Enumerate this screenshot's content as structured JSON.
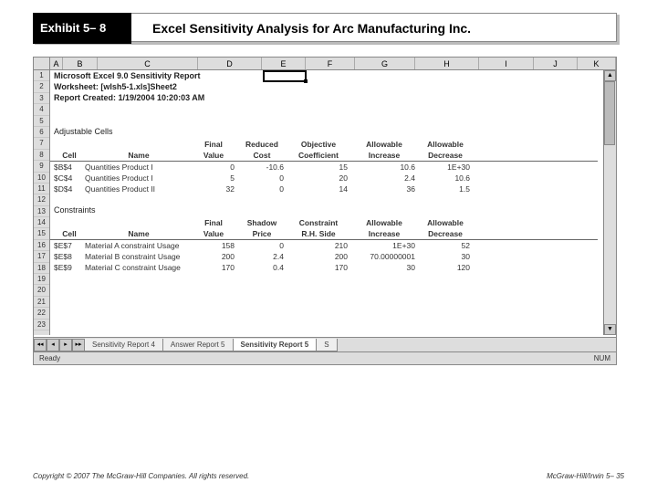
{
  "exhibit_label": "Exhibit 5– 8",
  "title": "Excel Sensitivity Analysis for Arc Manufacturing Inc.",
  "excel": {
    "columns": [
      "A",
      "B",
      "C",
      "D",
      "E",
      "F",
      "G",
      "H",
      "I",
      "J",
      "K"
    ],
    "row_count": 23,
    "active_cell": "E1",
    "report_header": {
      "l1": "Microsoft Excel 9.0 Sensitivity Report",
      "l2": "Worksheet: [wlsh5-1.xls]Sheet2",
      "l3": "Report Created: 1/19/2004 10:20:03 AM"
    },
    "section1_title": "Adjustable Cells",
    "section1_headers_top": {
      "cell": "",
      "name": "",
      "v1": "Final",
      "v2": "Reduced",
      "v3": "Objective",
      "v4": "Allowable",
      "v5": "Allowable"
    },
    "section1_headers_bottom": {
      "cell": "Cell",
      "name": "Name",
      "v1": "Value",
      "v2": "Cost",
      "v3": "Coefficient",
      "v4": "Increase",
      "v5": "Decrease"
    },
    "section1_rows": [
      {
        "cell": "$B$4",
        "name": "Quantities Product I",
        "v1": "0",
        "v2": "-10.6",
        "v3": "15",
        "v4": "10.6",
        "v5": "1E+30"
      },
      {
        "cell": "$C$4",
        "name": "Quantities Product I",
        "v1": "5",
        "v2": "0",
        "v3": "20",
        "v4": "2.4",
        "v5": "10.6"
      },
      {
        "cell": "$D$4",
        "name": "Quantities Product II",
        "v1": "32",
        "v2": "0",
        "v3": "14",
        "v4": "36",
        "v5": "1.5"
      }
    ],
    "section2_title": "Constraints",
    "section2_headers_top": {
      "cell": "",
      "name": "",
      "v1": "Final",
      "v2": "Shadow",
      "v3": "Constraint",
      "v4": "Allowable",
      "v5": "Allowable"
    },
    "section2_headers_bottom": {
      "cell": "Cell",
      "name": "Name",
      "v1": "Value",
      "v2": "Price",
      "v3": "R.H. Side",
      "v4": "Increase",
      "v5": "Decrease"
    },
    "section2_rows": [
      {
        "cell": "$E$7",
        "name": "Material A constraint Usage",
        "v1": "158",
        "v2": "0",
        "v3": "210",
        "v4": "1E+30",
        "v5": "52"
      },
      {
        "cell": "$E$8",
        "name": "Material B constraint Usage",
        "v1": "200",
        "v2": "2.4",
        "v3": "200",
        "v4": "70.00000001",
        "v5": "30"
      },
      {
        "cell": "$E$9",
        "name": "Material C constraint Usage",
        "v1": "170",
        "v2": "0.4",
        "v3": "170",
        "v4": "30",
        "v5": "120"
      }
    ],
    "tabs": [
      {
        "label": "Sensitivity Report 4",
        "active": false
      },
      {
        "label": "Answer Report 5",
        "active": false
      },
      {
        "label": "Sensitivity Report 5",
        "active": true
      },
      {
        "label": "S",
        "active": false
      }
    ],
    "status_left": "Ready",
    "status_right": "NUM"
  },
  "footer_left": "Copyright © 2007 The McGraw-Hill Companies. All rights reserved.",
  "footer_right": "McGraw-Hill/Irwin   5– 35"
}
